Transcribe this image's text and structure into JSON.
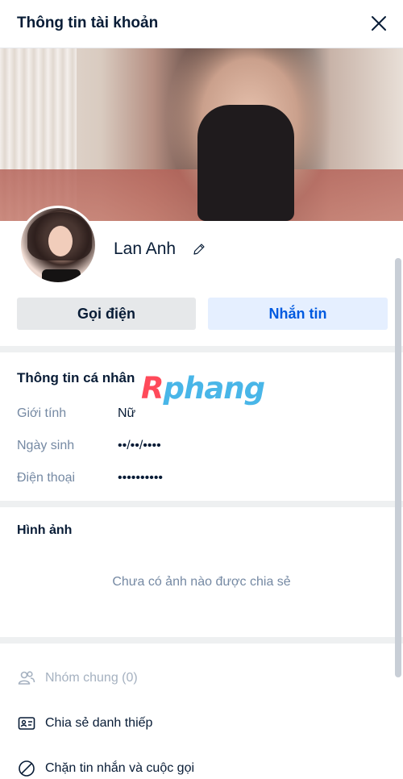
{
  "header": {
    "title": "Thông tin tài khoản",
    "close_icon": "close-icon"
  },
  "profile": {
    "name": "Lan Anh",
    "edit_icon": "pencil-icon"
  },
  "actions": {
    "call_label": "Gọi điện",
    "message_label": "Nhắn tin"
  },
  "personal_info": {
    "title": "Thông tin cá nhân",
    "rows": [
      {
        "label": "Giới tính",
        "value": "Nữ"
      },
      {
        "label": "Ngày sinh",
        "value": "••/••/••••"
      },
      {
        "label": "Điện thoại",
        "value": "••••••••••"
      }
    ]
  },
  "watermark": {
    "first": "R",
    "rest": "phang"
  },
  "images": {
    "title": "Hình ảnh",
    "empty_text": "Chưa có ảnh nào được chia sẻ"
  },
  "menu": [
    {
      "label": "Nhóm chung (0)",
      "icon": "group-icon",
      "disabled": true
    },
    {
      "label": "Chia sẻ danh thiếp",
      "icon": "contact-card-icon",
      "disabled": false
    },
    {
      "label": "Chặn tin nhắn và cuộc gọi",
      "icon": "block-icon",
      "disabled": false
    }
  ],
  "colors": {
    "accent": "#005ae0",
    "accent_bg": "#e5efff",
    "text": "#081c36",
    "muted": "#7589a3"
  }
}
